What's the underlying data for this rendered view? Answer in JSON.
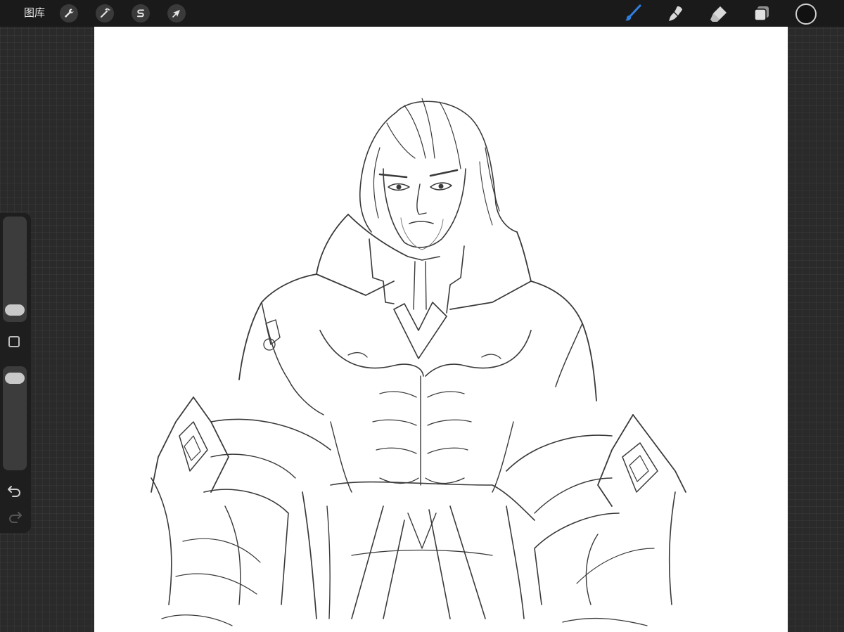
{
  "topbar": {
    "gallery_label": "图库",
    "actions_icon": "wrench-icon",
    "adjustments_icon": "magic-wand-icon",
    "selection_icon": "selection-s-icon",
    "transform_icon": "arrow-cursor-icon",
    "brush_icon": "brush-icon",
    "smudge_icon": "smudge-icon",
    "eraser_icon": "eraser-icon",
    "layers_icon": "layers-icon",
    "active_color": "#111111",
    "active_tool_color": "#2f7fe0"
  },
  "sidebar": {
    "brush_size": 0.05,
    "opacity": 0.95,
    "undo_icon": "undo-icon",
    "redo_icon": "redo-icon"
  }
}
